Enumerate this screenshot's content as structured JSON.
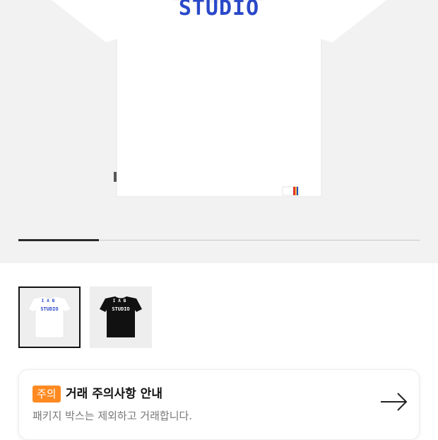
{
  "product": {
    "hero_logo_text": "STUDIO",
    "gallery_progress": 0.2,
    "thumbnails": [
      {
        "label": "white-tshirt",
        "logo_top": "IAB",
        "logo_text": "STUDIO",
        "color": "#eeeeee",
        "logo_color": "#2a49c9",
        "selected": true
      },
      {
        "label": "black-tshirt",
        "logo_top": "IAB",
        "logo_text": "STUDIO",
        "color": "#111111",
        "logo_color": "#ffffff",
        "selected": false
      }
    ]
  },
  "notice": {
    "badge": "주의",
    "title": "거래 주의사항 안내",
    "subtitle": "패키지 박스는 제외하고 거래합니다.",
    "accent": "#ff8a21"
  }
}
